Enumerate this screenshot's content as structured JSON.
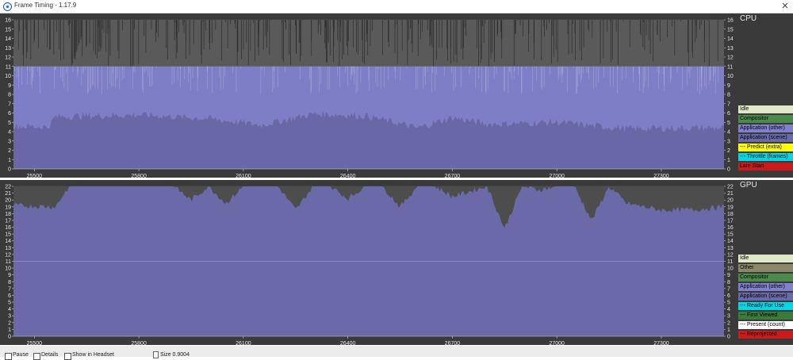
{
  "window": {
    "title": "Frame Timing - 1.17.9",
    "close_glyph": "✕"
  },
  "cpu": {
    "title": "CPU",
    "y_ticks": [
      "0",
      "1",
      "2",
      "3",
      "4",
      "5",
      "6",
      "7",
      "8",
      "9",
      "10",
      "11",
      "12",
      "13",
      "14",
      "15",
      "16"
    ],
    "x_ticks": [
      "25500",
      "25800",
      "26100",
      "26400",
      "26700",
      "27000",
      "27300"
    ],
    "legend": [
      {
        "label": "Idle",
        "color": "#e0e8c8",
        "text_color": "#000000"
      },
      {
        "label": "Compositor",
        "color": "#4a8a4a",
        "text_color": "#000000"
      },
      {
        "label": "Application (other)",
        "color": "#8080cc",
        "text_color": "#000000"
      },
      {
        "label": "Application (scene)",
        "color": "#6a6aaa",
        "text_color": "#000000"
      },
      {
        "label": "--- Predict (extra)",
        "color": "#ffff00",
        "text_color": "#000000"
      },
      {
        "label": "--- Throttle (frames)",
        "color": "#00d8e8",
        "text_color": "#000000"
      },
      {
        "label": "Late Start",
        "color": "#cc1a1a",
        "text_color": "#000000"
      }
    ]
  },
  "gpu": {
    "title": "GPU",
    "y_ticks": [
      "0",
      "1",
      "2",
      "3",
      "4",
      "5",
      "6",
      "7",
      "8",
      "9",
      "10",
      "11",
      "12",
      "13",
      "14",
      "15",
      "16",
      "17",
      "18",
      "19",
      "20",
      "21",
      "22"
    ],
    "x_ticks": [
      "25500",
      "25800",
      "26100",
      "26400",
      "26700",
      "27000",
      "27300"
    ],
    "legend": [
      {
        "label": "Idle",
        "color": "#e0e8c8",
        "text_color": "#000000"
      },
      {
        "label": "Other",
        "color": "#8a8a6a",
        "text_color": "#000000"
      },
      {
        "label": "Compositor",
        "color": "#4a8a4a",
        "text_color": "#000000"
      },
      {
        "label": "Application (other)",
        "color": "#8080cc",
        "text_color": "#000000"
      },
      {
        "label": "Application (scene)",
        "color": "#6a6aaa",
        "text_color": "#000000"
      },
      {
        "label": "--- Ready For Use",
        "color": "#00d8e8",
        "text_color": "#000000"
      },
      {
        "label": "--- First Viewed",
        "color": "#3a7a3a",
        "text_color": "#000000"
      },
      {
        "label": "--- Present (count)",
        "color": "#ffffff",
        "text_color": "#000000"
      },
      {
        "label": "--- Reprojected",
        "color": "#cc1a1a",
        "text_color": "#000000"
      }
    ]
  },
  "controls": {
    "pause_label": "Pause",
    "details_label": "Details",
    "headset_label": "Show in Headset",
    "scale_label": "Size 0.9004"
  },
  "chart_data": [
    {
      "type": "area",
      "title": "CPU",
      "x_range": [
        25440,
        27480
      ],
      "ylim": [
        0,
        16
      ],
      "x_ticks": [
        25500,
        25800,
        26100,
        26400,
        26700,
        27000,
        27300
      ],
      "series": [
        {
          "name": "Application (scene)",
          "x": [
            25440,
            25540,
            25560,
            25800,
            26000,
            26150,
            26300,
            26450,
            26600,
            26700,
            26800,
            27000,
            27200,
            27400,
            27480
          ],
          "values": [
            4.6,
            4.5,
            5.6,
            5.8,
            5.4,
            4.7,
            5.9,
            5.7,
            4.4,
            5.5,
            4.8,
            5.0,
            4.3,
            4.4,
            4.4
          ]
        },
        {
          "name": "Application (other)",
          "x": [
            25440,
            25800,
            26100,
            26400,
            26700,
            27000,
            27300,
            27480
          ],
          "values": [
            11.0,
            11.0,
            11.0,
            11.0,
            11.0,
            11.0,
            11.0,
            11.0
          ]
        },
        {
          "name": "Idle",
          "x": [
            25440,
            27480
          ],
          "values": [
            16,
            16
          ]
        }
      ]
    },
    {
      "type": "area",
      "title": "GPU",
      "x_range": [
        25440,
        27480
      ],
      "ylim": [
        0,
        22
      ],
      "x_ticks": [
        25500,
        25800,
        26100,
        26400,
        26700,
        27000,
        27300
      ],
      "series": [
        {
          "name": "Application (scene)",
          "x": [
            25440,
            25560,
            25600,
            25900,
            25950,
            26000,
            26050,
            26100,
            26200,
            26250,
            26300,
            26350,
            26400,
            26450,
            26500,
            26550,
            26600,
            26650,
            26700,
            26800,
            26850,
            26900,
            26950,
            27000,
            27050,
            27100,
            27150,
            27200,
            27300,
            27400,
            27480
          ],
          "values": [
            19.2,
            19.0,
            22,
            22,
            20.0,
            22,
            19.5,
            22,
            22,
            18.5,
            22,
            22,
            20.2,
            22,
            22,
            19.0,
            22,
            22,
            20.5,
            22,
            15.8,
            22,
            21.5,
            22,
            22,
            17.0,
            22,
            19.5,
            18.5,
            18.6,
            19.0
          ]
        }
      ]
    }
  ]
}
